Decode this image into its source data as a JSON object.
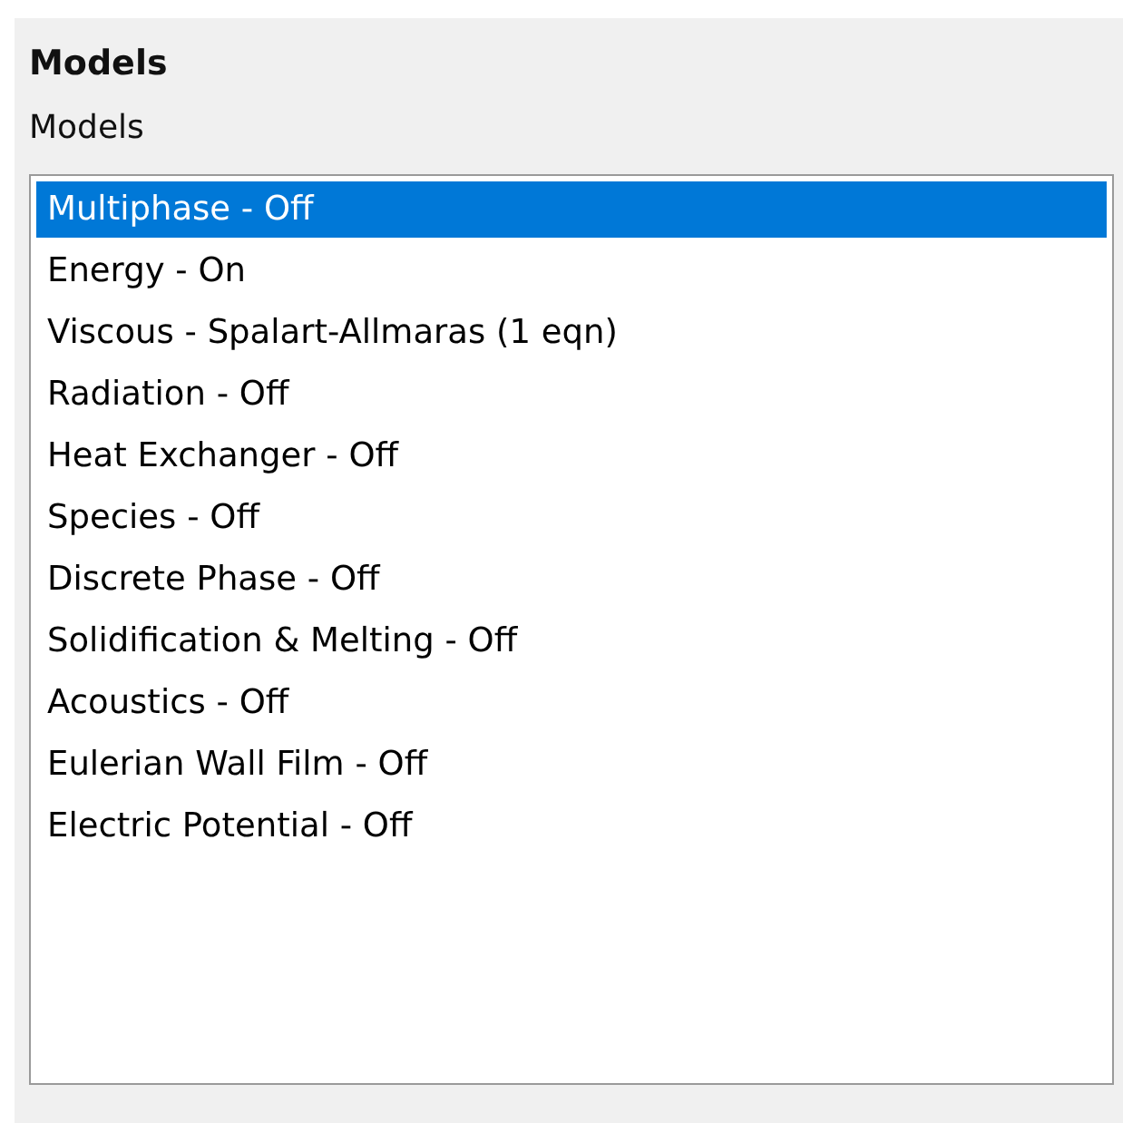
{
  "panel": {
    "title": "Models",
    "list_label": "Models"
  },
  "models": [
    {
      "label": "Multiphase - Off",
      "selected": true
    },
    {
      "label": "Energy - On",
      "selected": false
    },
    {
      "label": "Viscous - Spalart-Allmaras (1 eqn)",
      "selected": false
    },
    {
      "label": "Radiation - Off",
      "selected": false
    },
    {
      "label": "Heat Exchanger - Off",
      "selected": false
    },
    {
      "label": "Species - Off",
      "selected": false
    },
    {
      "label": "Discrete Phase - Off",
      "selected": false
    },
    {
      "label": "Solidification & Melting - Off",
      "selected": false
    },
    {
      "label": "Acoustics - Off",
      "selected": false
    },
    {
      "label": "Eulerian Wall Film - Off",
      "selected": false
    },
    {
      "label": "Electric Potential - Off",
      "selected": false
    }
  ]
}
